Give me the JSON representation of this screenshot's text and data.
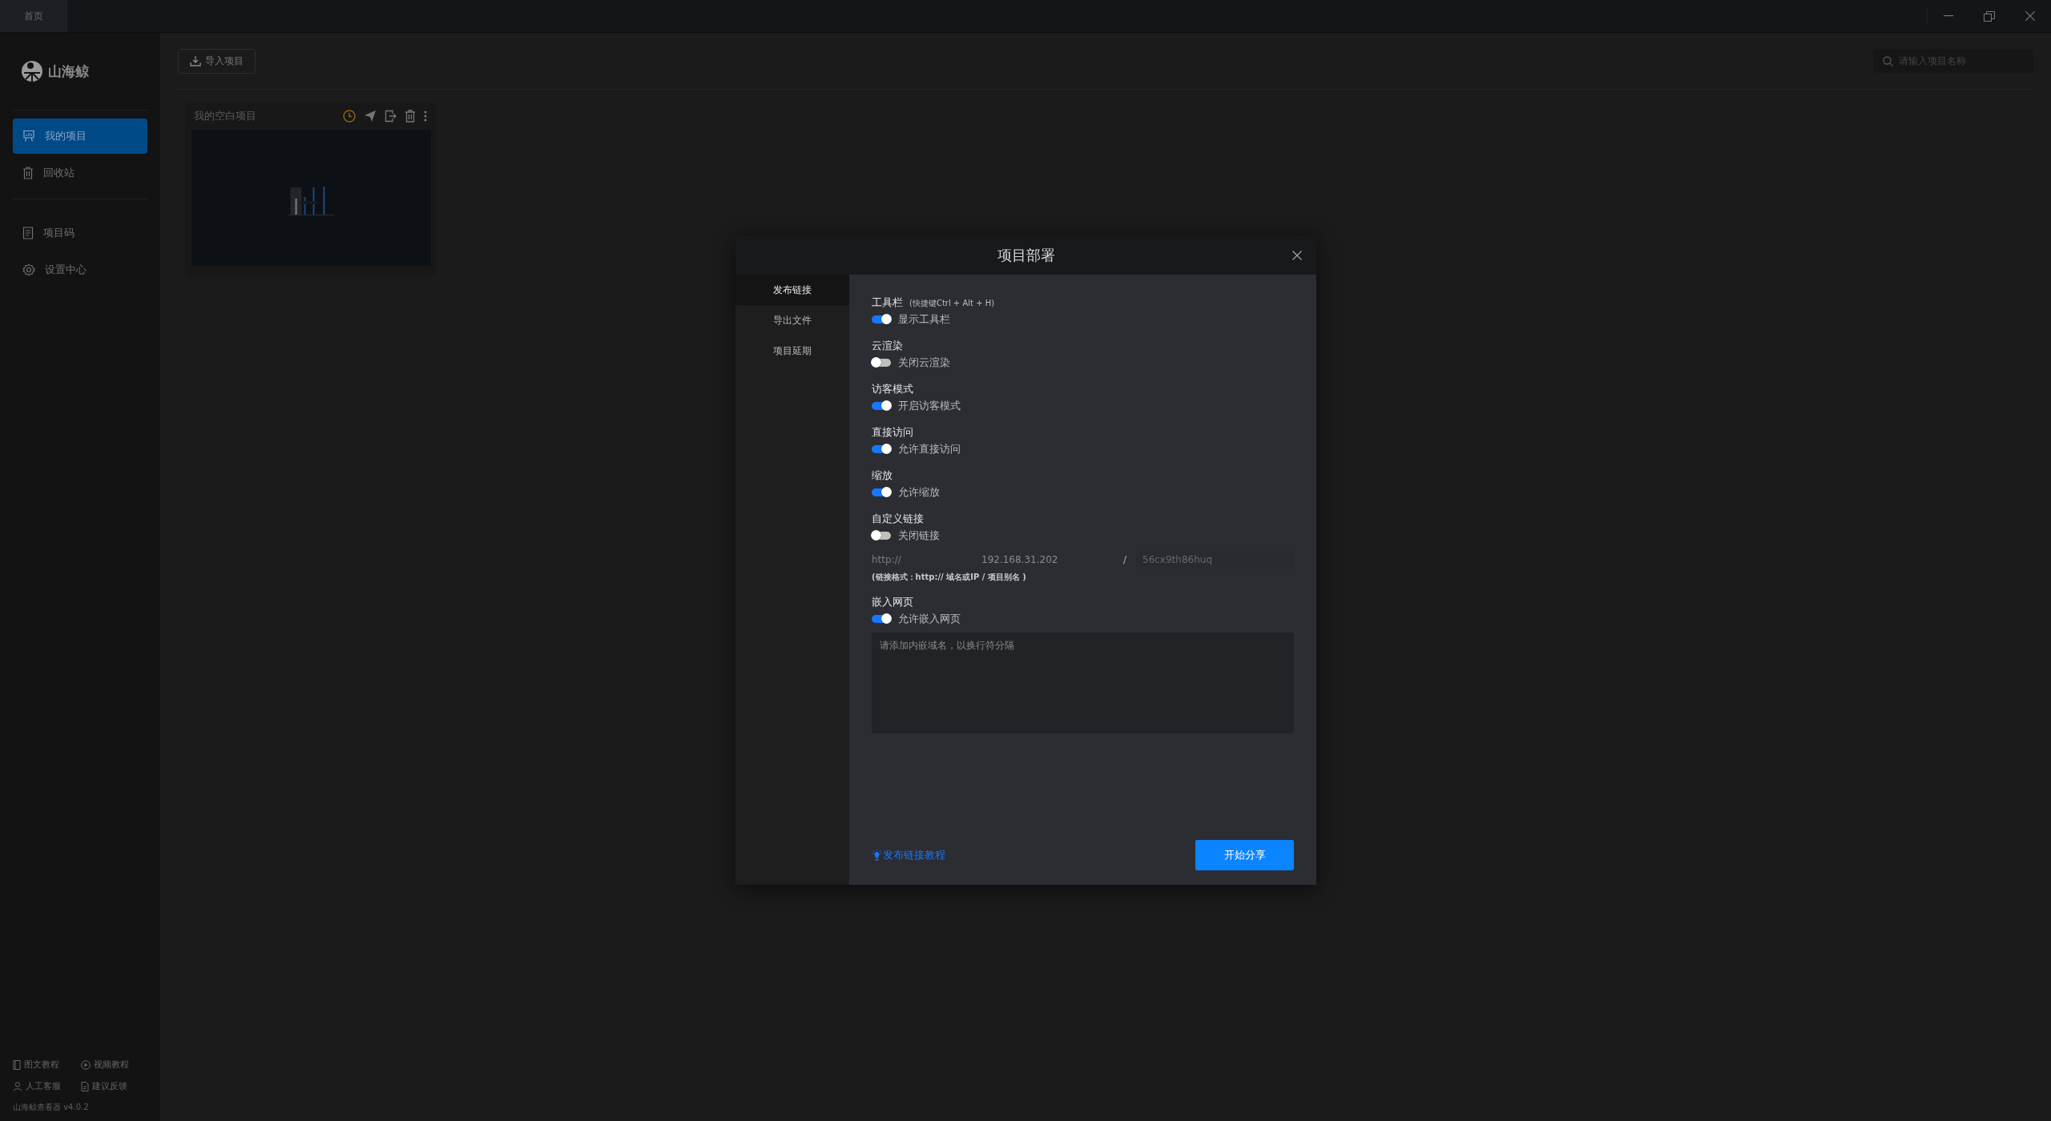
{
  "tabs": [
    {
      "label": "首页",
      "selected": true
    }
  ],
  "brand": {
    "name": "山海鲸"
  },
  "sidebar": {
    "groups": [
      [
        {
          "label": "我的项目",
          "selected": true
        },
        {
          "label": "回收站",
          "selected": false
        }
      ],
      [
        {
          "label": "项目码",
          "selected": false
        },
        {
          "label": "设置中心",
          "selected": false
        }
      ]
    ],
    "help_links": [
      "图文教程",
      "视频教程",
      "人工客服",
      "建议反馈"
    ],
    "version": "山海鲸查看器 v4.0.2"
  },
  "toolbar": {
    "import_button": "导入项目",
    "search": {
      "placeholder": "请输入项目名称"
    }
  },
  "projects": [
    {
      "title": "我的空白项目"
    }
  ],
  "dialog": {
    "title": "项目部署",
    "nav": [
      {
        "label": "发布链接",
        "selected": true
      },
      {
        "label": "导出文件",
        "selected": false
      },
      {
        "label": "项目延期",
        "selected": false
      }
    ],
    "settings": [
      {
        "kind": "toggle",
        "title": "工具栏",
        "hint": "(快捷键Ctrl + Alt + H)",
        "on": true,
        "label": "显示工具栏"
      },
      {
        "kind": "toggle",
        "title": "云渲染",
        "on": false,
        "label": "关闭云渲染"
      },
      {
        "kind": "toggle",
        "title": "访客模式",
        "on": true,
        "label": "开启访客模式"
      },
      {
        "kind": "toggle",
        "title": "直接访问",
        "on": true,
        "label": "允许直接访问"
      },
      {
        "kind": "toggle",
        "title": "缩放",
        "on": true,
        "label": "允许缩放"
      },
      {
        "kind": "link",
        "title": "自定义链接",
        "on": false,
        "label": "关闭链接",
        "scheme": "http://",
        "host": "192.168.31.202",
        "separator": "/",
        "alias": "56cx9th86huq",
        "format_hint": "(链接格式：http:// 域名或IP / 项目别名 )"
      },
      {
        "kind": "embed",
        "title": "嵌入网页",
        "on": true,
        "label": "允许嵌入网页",
        "placeholder": "请添加内嵌域名，以换行符分隔"
      }
    ],
    "tutorial_link": "发布链接教程",
    "primary_button": "开始分享"
  }
}
